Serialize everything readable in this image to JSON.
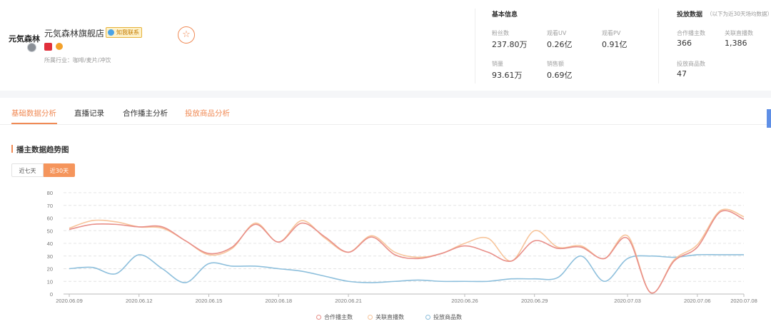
{
  "shop": {
    "logo_text": "元気森林",
    "name": "元気森林旗舰店",
    "contact_badge": "知我联系",
    "industry": "所属行业：咖啡/麦片/冲饮"
  },
  "basic_info": {
    "title": "基本信息",
    "stats": [
      {
        "label": "粉丝数",
        "value": "237.80万"
      },
      {
        "label": "观看UV",
        "value": "0.26亿"
      },
      {
        "label": "观看PV",
        "value": "0.91亿"
      },
      {
        "label": "销量",
        "value": "93.61万"
      },
      {
        "label": "销售额",
        "value": "0.69亿"
      }
    ]
  },
  "placement": {
    "title": "投放数据",
    "note": "（以下为近30天场均数据）",
    "stats": [
      {
        "label": "合作播主数",
        "value": "366"
      },
      {
        "label": "关联直播数",
        "value": "1,386"
      },
      {
        "label": "投放商品数",
        "value": "47"
      }
    ]
  },
  "tabs": [
    {
      "label": "基础数据分析"
    },
    {
      "label": "直播记录"
    },
    {
      "label": "合作播主分析"
    },
    {
      "label": "投放商品分析"
    }
  ],
  "chart_section": {
    "title": "播主数据趋势图",
    "range_buttons": [
      "近七天",
      "近30天"
    ],
    "selected_range": "近30天"
  },
  "chart_data": {
    "type": "line",
    "x": [
      "2020.06.09",
      "2020.06.10",
      "2020.06.11",
      "2020.06.12",
      "2020.06.13",
      "2020.06.14",
      "2020.06.15",
      "2020.06.16",
      "2020.06.17",
      "2020.06.18",
      "2020.06.19",
      "2020.06.20",
      "2020.06.21",
      "2020.06.22",
      "2020.06.23",
      "2020.06.24",
      "2020.06.25",
      "2020.06.26",
      "2020.06.27",
      "2020.06.28",
      "2020.06.29",
      "2020.06.30",
      "2020.07.01",
      "2020.07.02",
      "2020.07.03",
      "2020.07.04",
      "2020.07.05",
      "2020.07.06",
      "2020.07.07",
      "2020.07.08"
    ],
    "x_tick_labels": [
      "2020.06.09",
      "2020.06.12",
      "2020.06.15",
      "2020.06.18",
      "2020.06.21",
      "2020.06.26",
      "2020.06.29",
      "2020.07.03",
      "2020.07.06",
      "2020.07.08"
    ],
    "ylim": [
      0,
      80
    ],
    "y_ticks": [
      0,
      10,
      20,
      30,
      40,
      50,
      60,
      70,
      80
    ],
    "grid": true,
    "legend_position": "bottom-center",
    "series": [
      {
        "name": "合作播主数",
        "color": "#e88f89",
        "values": [
          51,
          55,
          55,
          53,
          53,
          42,
          32,
          37,
          55,
          41,
          56,
          45,
          33,
          45,
          31,
          28,
          32,
          38,
          33,
          26,
          42,
          36,
          37,
          28,
          44,
          1,
          26,
          37,
          65,
          59
        ]
      },
      {
        "name": "关联直播数",
        "color": "#f7c49a",
        "values": [
          52,
          58,
          57,
          53,
          52,
          42,
          31,
          36,
          56,
          41,
          58,
          44,
          33,
          46,
          33,
          29,
          32,
          40,
          44,
          26,
          50,
          37,
          38,
          28,
          46,
          1,
          27,
          39,
          66,
          61
        ]
      },
      {
        "name": "投放商品数",
        "color": "#8dbfdc",
        "values": [
          20,
          21,
          16,
          31,
          20,
          9,
          24,
          22,
          22,
          20,
          18,
          14,
          10,
          9,
          10,
          11,
          10,
          10,
          10,
          12,
          12,
          13,
          30,
          10,
          28,
          30,
          29,
          31,
          31,
          31
        ]
      }
    ]
  }
}
